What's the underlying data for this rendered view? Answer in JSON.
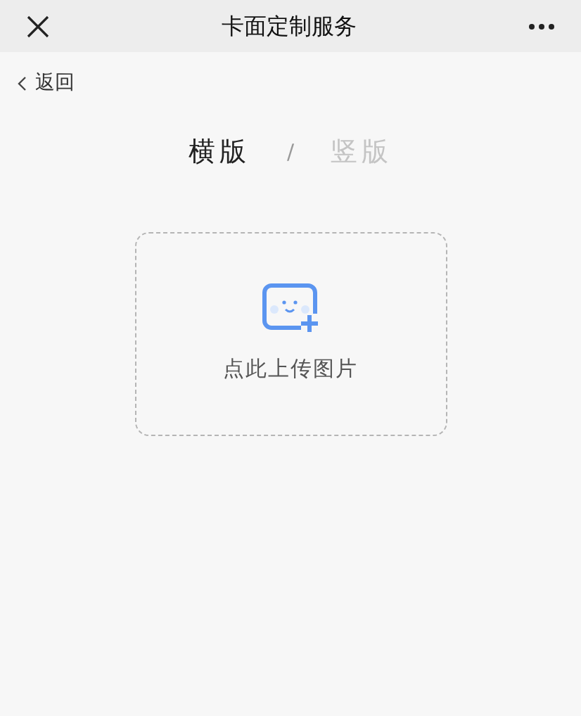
{
  "window": {
    "title": "卡面定制服务"
  },
  "back": {
    "label": "返回"
  },
  "tabs": [
    {
      "label": "横版",
      "selected": true
    },
    {
      "label": "竖版",
      "selected": false
    }
  ],
  "tab_separator": "/",
  "upload": {
    "label": "点此上传图片"
  }
}
